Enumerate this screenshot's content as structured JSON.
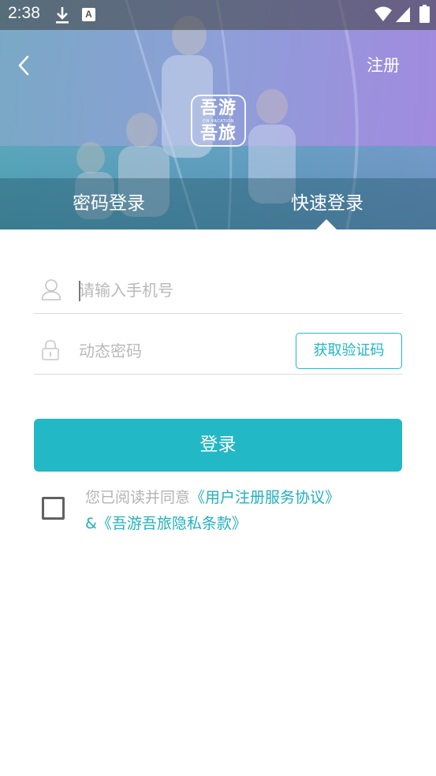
{
  "status_bar": {
    "time": "2:38",
    "icons": [
      "download-icon",
      "a-icon",
      "wifi-icon",
      "signal-icon",
      "battery-icon"
    ],
    "a_glyph": "A"
  },
  "header": {
    "register_label": "注册",
    "logo": {
      "line1": "吾游",
      "subtitle": "ON VACATION",
      "line2": "吾旅"
    }
  },
  "tabs": [
    {
      "label": "密码登录",
      "selected": false
    },
    {
      "label": "快速登录",
      "selected": true
    }
  ],
  "form": {
    "phone": {
      "value": "",
      "placeholder": "请输入手机号"
    },
    "code": {
      "value": "",
      "placeholder": "动态密码"
    },
    "get_code_label": "获取验证码",
    "login_label": "登录"
  },
  "agreement": {
    "checked": false,
    "prefix": "您已阅读并同意",
    "link1": "《用户注册服务协议》",
    "joiner": "&",
    "link2": "《吾游吾旅隐私条款》"
  },
  "colors": {
    "accent": "#22b8c5",
    "link": "#22b0be",
    "muted_text": "#b3b3b3",
    "divider": "#dcdcdc"
  }
}
